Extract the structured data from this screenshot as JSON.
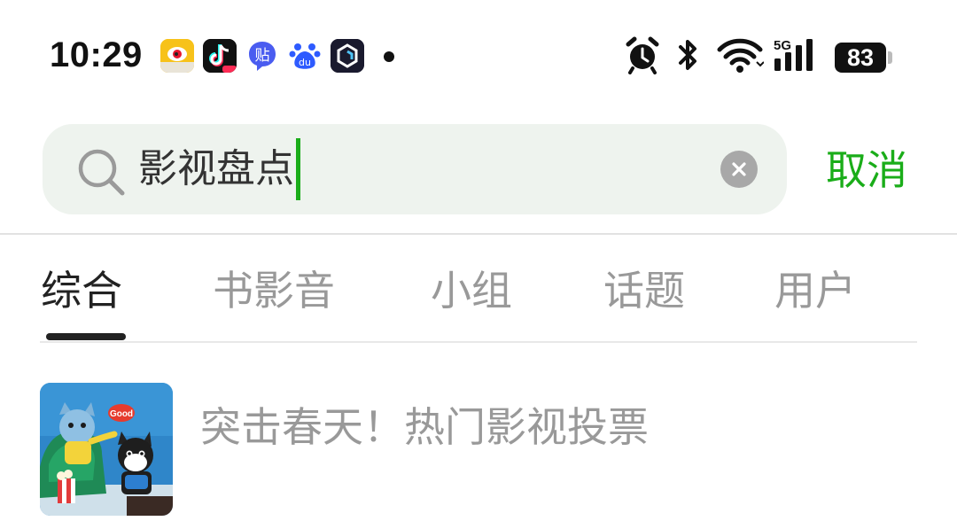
{
  "status_bar": {
    "time": "10:29",
    "apps": [
      {
        "icon": "weibo-icon",
        "color": "#f5b800"
      },
      {
        "icon": "douyin-icon",
        "color": "#111111"
      },
      {
        "icon": "tieba-icon",
        "color": "#3d5afe",
        "label": "贴"
      },
      {
        "icon": "baidu-icon",
        "color": "#2e5bff",
        "label": "du"
      },
      {
        "icon": "app-icon",
        "color": "#1a1a2e"
      }
    ],
    "battery": "83"
  },
  "search": {
    "query": "影视盘点",
    "cancel_label": "取消"
  },
  "tabs": [
    {
      "label": "综合",
      "active": true
    },
    {
      "label": "书影音",
      "active": false
    },
    {
      "label": "小组",
      "active": false
    },
    {
      "label": "话题",
      "active": false
    },
    {
      "label": "用户",
      "active": false
    }
  ],
  "results": [
    {
      "title": "突击春天！热门影视投票",
      "thumb_badge": "Good"
    }
  ],
  "colors": {
    "accent": "#1aad19",
    "search_bg": "#eef3ee",
    "muted_text": "#999999"
  }
}
